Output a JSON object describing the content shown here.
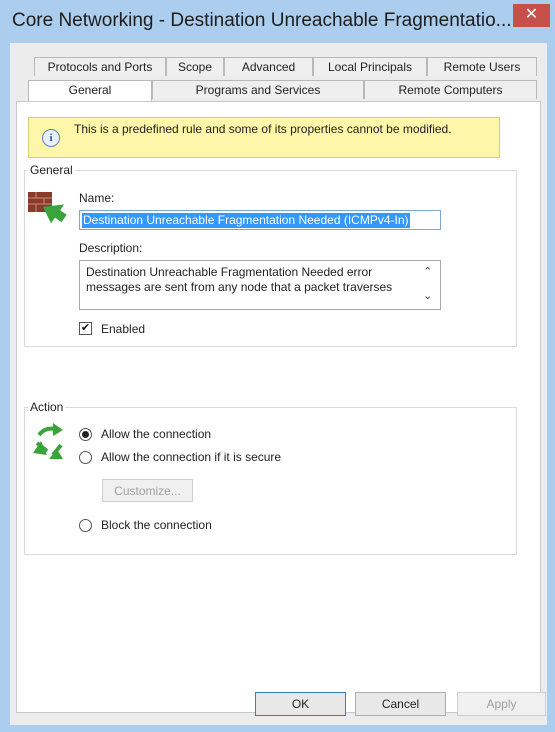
{
  "window": {
    "title": "Core Networking - Destination Unreachable Fragmentatio...",
    "close_glyph": "✕"
  },
  "tabs": {
    "row1": [
      "Protocols and Ports",
      "Scope",
      "Advanced",
      "Local Principals",
      "Remote Users"
    ],
    "row2": [
      "General",
      "Programs and Services",
      "Remote Computers"
    ],
    "active": "General"
  },
  "info": {
    "icon": "info-icon",
    "icon_glyph": "i",
    "text": "This is a predefined rule and some of its properties cannot be modified."
  },
  "general": {
    "group_label": "General",
    "icon": "firewall-rule-icon",
    "name_label": "Name:",
    "name_value": "Destination Unreachable Fragmentation Needed (ICMPv4-In)",
    "description_label": "Description:",
    "description_value": "Destination Unreachable Fragmentation Needed error messages are sent from any node that a packet traverses",
    "enabled_label": "Enabled",
    "enabled_checked": true,
    "check_glyph": "✔"
  },
  "action": {
    "group_label": "Action",
    "icon": "allow-arrows-icon",
    "options": [
      {
        "label": "Allow the connection",
        "checked": true
      },
      {
        "label": "Allow the connection if it is secure",
        "checked": false
      },
      {
        "label": "Block the connection",
        "checked": false
      }
    ],
    "customize_label": "Customize..."
  },
  "buttons": {
    "ok": "OK",
    "cancel": "Cancel",
    "apply": "Apply"
  }
}
